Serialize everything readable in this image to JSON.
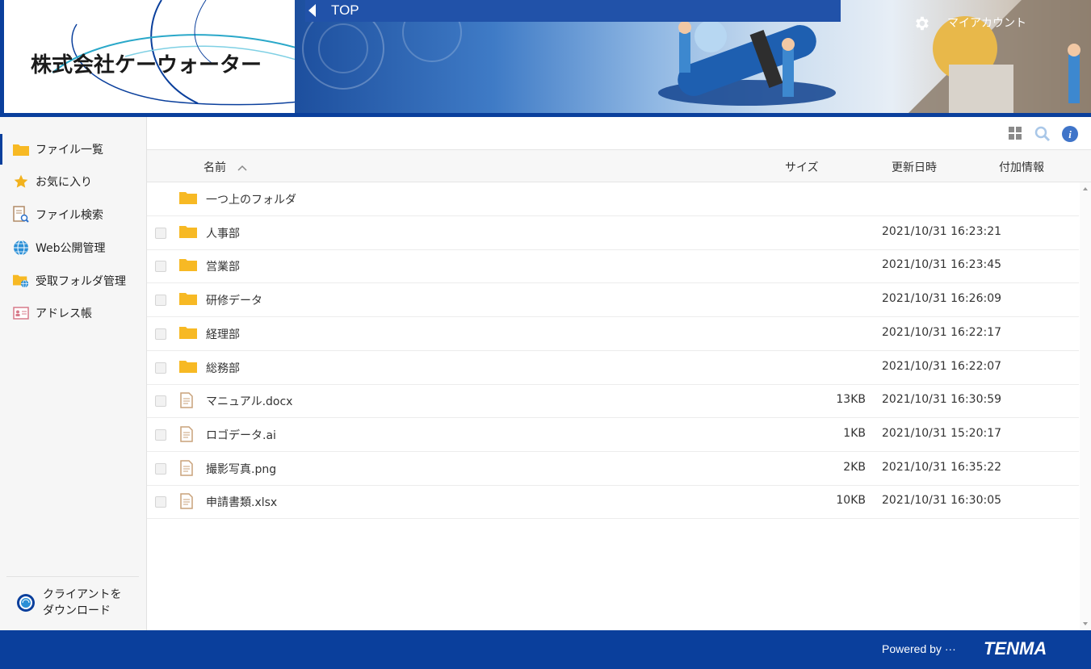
{
  "header": {
    "company_name": "株式会社ケーウォーター",
    "breadcrumb": "TOP",
    "my_account": "マイアカウント"
  },
  "sidebar": {
    "items": [
      {
        "label": "ファイル一覧",
        "icon": "folder-icon"
      },
      {
        "label": "お気に入り",
        "icon": "star-icon"
      },
      {
        "label": "ファイル検索",
        "icon": "file-search-icon"
      },
      {
        "label": "Web公開管理",
        "icon": "globe-icon"
      },
      {
        "label": "受取フォルダ管理",
        "icon": "receive-folder-icon"
      },
      {
        "label": "アドレス帳",
        "icon": "address-book-icon"
      }
    ],
    "client_download": {
      "line1": "クライアントを",
      "line2": "ダウンロード"
    }
  },
  "toolbar": {
    "icons": [
      "grid-view-icon",
      "search-icon",
      "info-icon"
    ]
  },
  "columns": {
    "name": "名前",
    "sort_indicator": "^",
    "size": "サイズ",
    "updated": "更新日時",
    "extra": "付加情報"
  },
  "rows": [
    {
      "name": "一つ上のフォルダ",
      "type": "folder",
      "size": "",
      "date": ""
    },
    {
      "name": "人事部",
      "type": "folder",
      "size": "",
      "date": "2021/10/31 16:23:21"
    },
    {
      "name": "営業部",
      "type": "folder",
      "size": "",
      "date": "2021/10/31 16:23:45"
    },
    {
      "name": "研修データ",
      "type": "folder",
      "size": "",
      "date": "2021/10/31 16:26:09"
    },
    {
      "name": "経理部",
      "type": "folder",
      "size": "",
      "date": "2021/10/31 16:22:17"
    },
    {
      "name": "総務部",
      "type": "folder",
      "size": "",
      "date": "2021/10/31 16:22:07"
    },
    {
      "name": "マニュアル.docx",
      "type": "file",
      "size": "13KB",
      "date": "2021/10/31 16:30:59"
    },
    {
      "name": "ロゴデータ.ai",
      "type": "file",
      "size": "1KB",
      "date": "2021/10/31 15:20:17"
    },
    {
      "name": "撮影写真.png",
      "type": "file",
      "size": "2KB",
      "date": "2021/10/31 16:35:22"
    },
    {
      "name": "申請書類.xlsx",
      "type": "file",
      "size": "10KB",
      "date": "2021/10/31 16:30:05"
    }
  ],
  "footer": {
    "powered_by": "Powered by ···",
    "brand": "TENMA"
  },
  "colors": {
    "brand_blue": "#0a3f9c",
    "folder_yellow": "#f7b924",
    "file_tan": "#c9a27a"
  }
}
